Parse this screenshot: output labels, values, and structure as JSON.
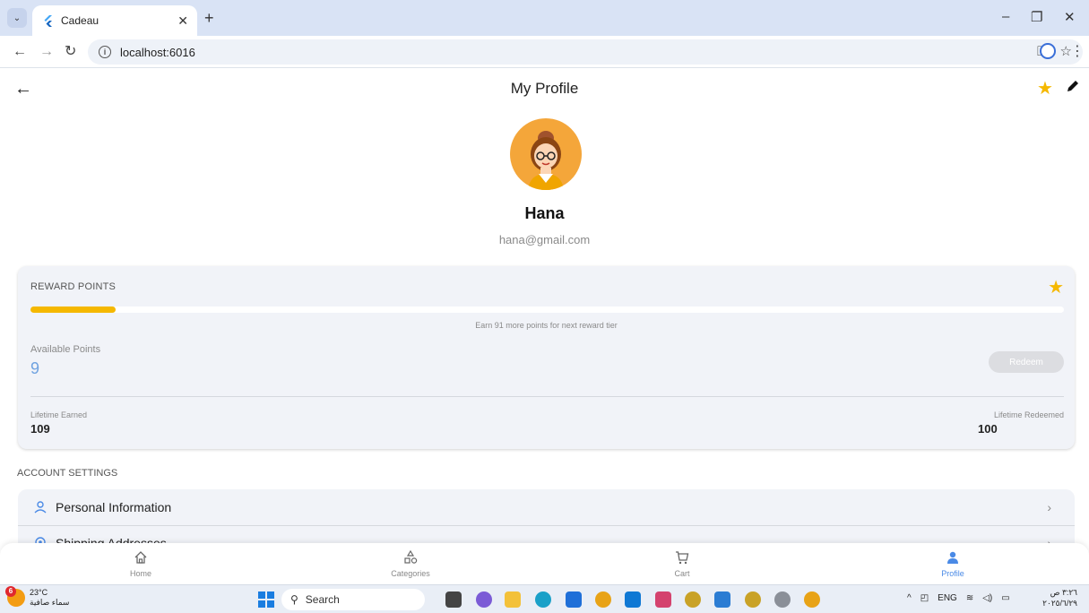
{
  "browser": {
    "tab_title": "Cadeau",
    "url": "localhost:6016"
  },
  "app": {
    "page_title": "My Profile",
    "user": {
      "name": "Hana",
      "email": "hana@gmail.com"
    },
    "rewards": {
      "title": "REWARD POINTS",
      "progress_fraction": 0.082,
      "progress_text": "Earn 91 more points for next reward tier",
      "available_label": "Available Points",
      "available_value": "9",
      "redeem_label": "Redeem",
      "lifetime_earned_label": "Lifetime Earned",
      "lifetime_earned_value": "109",
      "lifetime_redeemed_label": "Lifetime Redeemed",
      "lifetime_redeemed_value": "100"
    },
    "account_settings": {
      "title": "ACCOUNT SETTINGS",
      "items": [
        {
          "label": "Personal Information",
          "icon": "person-outline-icon"
        },
        {
          "label": "Shipping Addresses",
          "icon": "location-pin-icon"
        }
      ]
    },
    "bottom_nav": [
      {
        "label": "Home",
        "icon": "home-icon"
      },
      {
        "label": "Categories",
        "icon": "categories-icon"
      },
      {
        "label": "Cart",
        "icon": "cart-icon"
      },
      {
        "label": "Profile",
        "icon": "person-icon",
        "active": true
      }
    ],
    "colors": {
      "accent": "#f5b800",
      "active_nav": "#4a8ae6",
      "points_blue": "#6fa2e0"
    }
  },
  "taskbar": {
    "weather_temp": "23°C",
    "weather_desc": "سماء صافية",
    "weather_badge": "6",
    "search_label": "Search",
    "language": "ENG",
    "time": "٣:٢٦ ص",
    "date": "٢٠٢٥/٦/٢٩"
  }
}
